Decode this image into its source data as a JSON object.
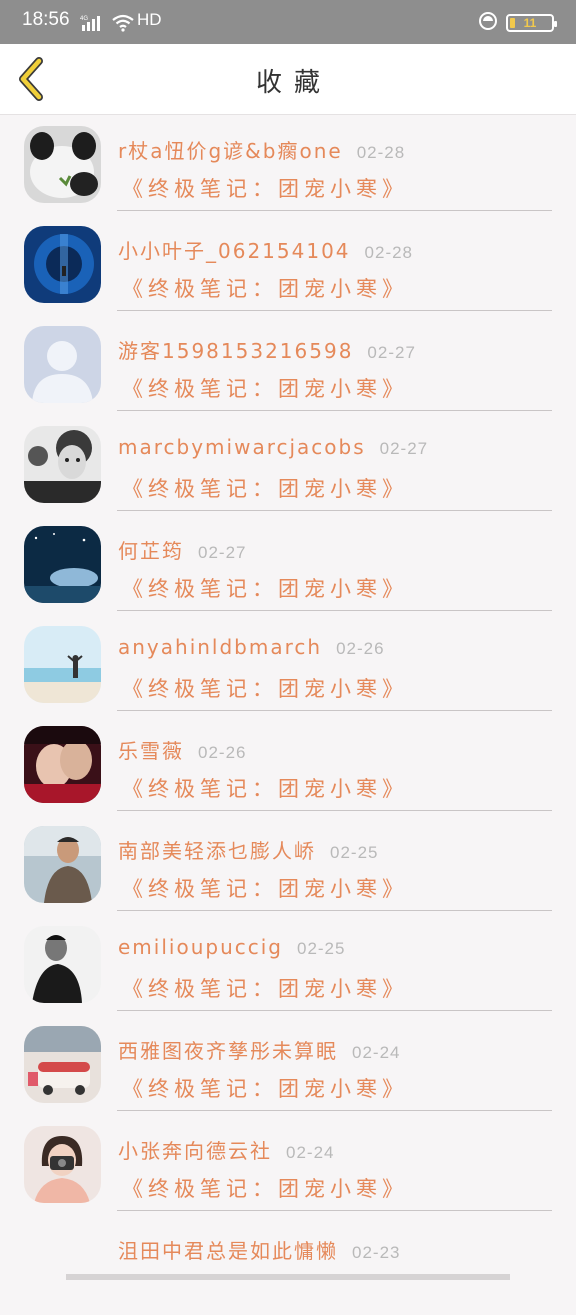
{
  "status_bar": {
    "time": "18:56",
    "network_label": "HD",
    "battery_level": "11",
    "battery_fraction": 0.11
  },
  "header": {
    "title": "收藏"
  },
  "favorites": [
    {
      "name": "r杖a忸价g谚&b瘸one",
      "date": "02-28",
      "book": "《终极笔记：团宠小寒》",
      "avatar": "panda-pillow-photo"
    },
    {
      "name": "小小叶子_062154104",
      "date": "02-28",
      "book": "《终极笔记：团宠小寒》",
      "avatar": "blue-staircase-photo"
    },
    {
      "name": "游客1598153216598",
      "date": "02-27",
      "book": "《终极笔记：团宠小寒》",
      "avatar": "default-user-silhouette"
    },
    {
      "name": "marcbymiwarcjacobs",
      "date": "02-27",
      "book": "《终极笔记：团宠小寒》",
      "avatar": "child-portrait-bw"
    },
    {
      "name": "何芷筠",
      "date": "02-27",
      "book": "《终极笔记：团宠小寒》",
      "avatar": "night-sky-whale"
    },
    {
      "name": "anyahinldbmarch",
      "date": "02-26",
      "book": "《终极笔记：团宠小寒》",
      "avatar": "beach-person"
    },
    {
      "name": "乐雪薇",
      "date": "02-26",
      "book": "《终极笔记：团宠小寒》",
      "avatar": "couple-drama-still"
    },
    {
      "name": "南部美轻添乜膨人峤",
      "date": "02-25",
      "book": "《终极笔记：团宠小寒》",
      "avatar": "man-city-portrait"
    },
    {
      "name": "emilioupuccig",
      "date": "02-25",
      "book": "《终极笔记：团宠小寒》",
      "avatar": "man-bw-portrait"
    },
    {
      "name": "西雅图夜齐孳彤未算眠",
      "date": "02-24",
      "book": "《终极笔记：团宠小寒》",
      "avatar": "vintage-van"
    },
    {
      "name": "小张奔向德云社",
      "date": "02-24",
      "book": "《终极笔记：团宠小寒》",
      "avatar": "girl-with-camera"
    },
    {
      "name": "沮田中君总是如此慵懒",
      "date": "02-23",
      "book": "",
      "avatar": "partial-hidden"
    }
  ],
  "colors": {
    "accent_orange": "#e5895a",
    "back_arrow_yellow": "#f0cf3a",
    "date_gray": "#b9b9b9",
    "background": "#f7f5f6"
  }
}
